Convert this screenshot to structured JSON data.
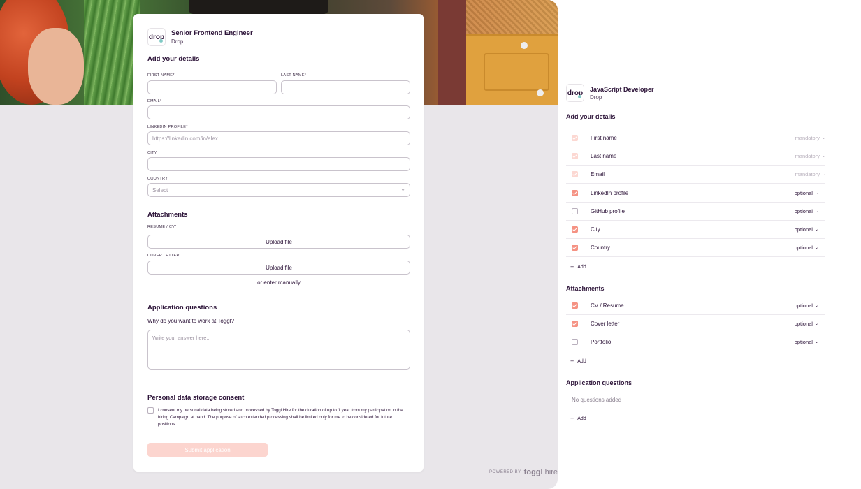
{
  "preview": {
    "job_title": "Senior Frontend Engineer",
    "company": "Drop",
    "logo_text": "drop",
    "details_heading": "Add your details",
    "first_name_label": "FIRST NAME*",
    "last_name_label": "LAST NAME*",
    "email_label": "EMAIL*",
    "linkedin_label": "LINKEDIN PROFILE*",
    "linkedin_placeholder": "https://linkedin.com/in/alex",
    "city_label": "CITY",
    "country_label": "COUNTRY",
    "country_value": "Select",
    "attachments_heading": "Attachments",
    "resume_label": "RESUME / CV*",
    "resume_button": "Upload file",
    "cover_label": "COVER LETTER",
    "cover_button": "Upload file",
    "enter_manually": "or enter manually",
    "questions_heading": "Application questions",
    "question_text": "Why do you want to work at Toggl?",
    "answer_placeholder": "Write your answer here...",
    "consent_heading": "Personal data storage consent",
    "consent_text": "I consent my personal data being stored and processed by Toggl Hire for the duration of up to 1 year from my participation in the hiring Campaign at hand. The purpose of such extended processing shall be limited only for me to be considered for future positions.",
    "submit_label": "Submit application",
    "powered_by": "POWERED BY",
    "powered_brand": "toggl",
    "powered_brand_suffix": "hire"
  },
  "settings": {
    "job_title": "JavaScript Developer",
    "company": "Drop",
    "logo_text": "drop",
    "details_heading": "Add your details",
    "detail_fields": [
      {
        "name": "First name",
        "requirement": "mandatory",
        "state": "locked"
      },
      {
        "name": "Last name",
        "requirement": "mandatory",
        "state": "locked"
      },
      {
        "name": "Email",
        "requirement": "mandatory",
        "state": "locked"
      },
      {
        "name": "LinkedIn profile",
        "requirement": "optional",
        "state": "checked"
      },
      {
        "name": "GitHub profile",
        "requirement": "optional",
        "state": "unchecked"
      },
      {
        "name": "City",
        "requirement": "optional",
        "state": "checked"
      },
      {
        "name": "Country",
        "requirement": "optional",
        "state": "checked"
      }
    ],
    "add_label": "Add",
    "attachments_heading": "Attachments",
    "attachment_fields": [
      {
        "name": "CV / Resume",
        "requirement": "optional",
        "state": "checked"
      },
      {
        "name": "Cover letter",
        "requirement": "optional",
        "state": "checked"
      },
      {
        "name": "Portfolio",
        "requirement": "optional",
        "state": "unchecked"
      }
    ],
    "questions_heading": "Application questions",
    "no_questions": "No questions added"
  },
  "colors": {
    "accent": "#f59283",
    "accent_faded": "#fcd5cf",
    "text": "#2c1338",
    "background": "#e9e6ea"
  }
}
